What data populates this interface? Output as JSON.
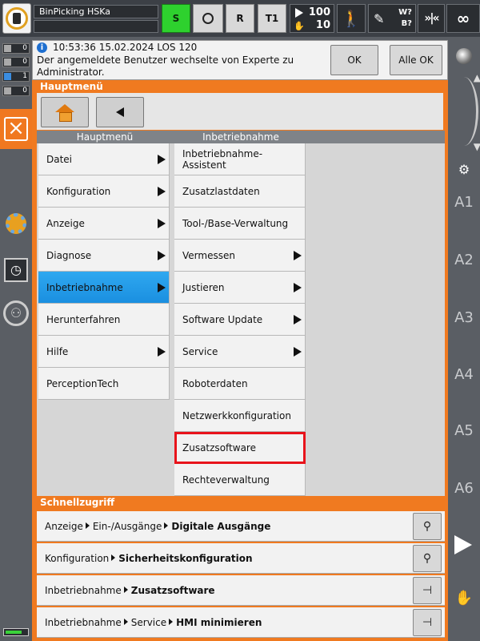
{
  "topbar": {
    "project_name": "BinPicking HSKa",
    "mode_s": "S",
    "mode_r": "R",
    "mode_t1": "T1",
    "override_prog": "100",
    "override_jog": "10",
    "tool_base": "W?\nB?",
    "increment_icon": "»|«",
    "infinity": "∞"
  },
  "counters": [
    {
      "type": "error",
      "value": "0"
    },
    {
      "type": "warning",
      "value": "0"
    },
    {
      "type": "info",
      "value": "1"
    },
    {
      "type": "wait",
      "value": "0"
    }
  ],
  "message": {
    "timestamp": "10:53:36 15.02.2024 LOS 120",
    "text": "Der angemeldete Benutzer wechselte von Experte zu Administrator.",
    "ok_label": "OK",
    "all_ok_label": "Alle OK"
  },
  "main": {
    "title": "Hauptmenü",
    "col1_header": "Hauptmenü",
    "col2_header": "Inbetriebnahme",
    "menu": [
      {
        "label": "Datei",
        "submenu": true
      },
      {
        "label": "Konfiguration",
        "submenu": true
      },
      {
        "label": "Anzeige",
        "submenu": true
      },
      {
        "label": "Diagnose",
        "submenu": true
      },
      {
        "label": "Inbetriebnahme",
        "submenu": true,
        "active": true
      },
      {
        "label": "Herunterfahren",
        "submenu": false
      },
      {
        "label": "Hilfe",
        "submenu": true
      },
      {
        "label": "PerceptionTech",
        "submenu": false
      }
    ],
    "submenu": [
      {
        "label": "Inbetriebnahme-Assistent",
        "submenu": false
      },
      {
        "label": "Zusatzlastdaten",
        "submenu": false
      },
      {
        "label": "Tool-/Base-Verwaltung",
        "submenu": false
      },
      {
        "label": "Vermessen",
        "submenu": true
      },
      {
        "label": "Justieren",
        "submenu": true
      },
      {
        "label": "Software Update",
        "submenu": true
      },
      {
        "label": "Service",
        "submenu": true
      },
      {
        "label": "Roboterdaten",
        "submenu": false
      },
      {
        "label": "Netzwerkkonfiguration",
        "submenu": false
      },
      {
        "label": "Zusatzsoftware",
        "submenu": false,
        "highlighted": true
      },
      {
        "label": "Rechteverwaltung",
        "submenu": false
      }
    ]
  },
  "quick_access": {
    "title": "Schnellzugriff",
    "items": [
      {
        "path": [
          "Anzeige",
          "Ein-/Ausgänge"
        ],
        "target": "Digitale Ausgänge",
        "pin": "unpinned"
      },
      {
        "path": [
          "Konfiguration"
        ],
        "target": "Sicherheitskonfiguration",
        "pin": "unpinned"
      },
      {
        "path": [
          "Inbetriebnahme"
        ],
        "target": "Zusatzsoftware",
        "pin": "pinned"
      },
      {
        "path": [
          "Inbetriebnahme",
          "Service"
        ],
        "target": "HMI minimieren",
        "pin": "pinned"
      }
    ]
  },
  "axes": [
    "A1",
    "A2",
    "A3",
    "A4",
    "A5",
    "A6"
  ],
  "colors": {
    "accent_orange": "#f07a20",
    "active_blue": "#1a8fe0",
    "highlight_red": "#e8131b",
    "mode_green": "#2ed12e"
  }
}
